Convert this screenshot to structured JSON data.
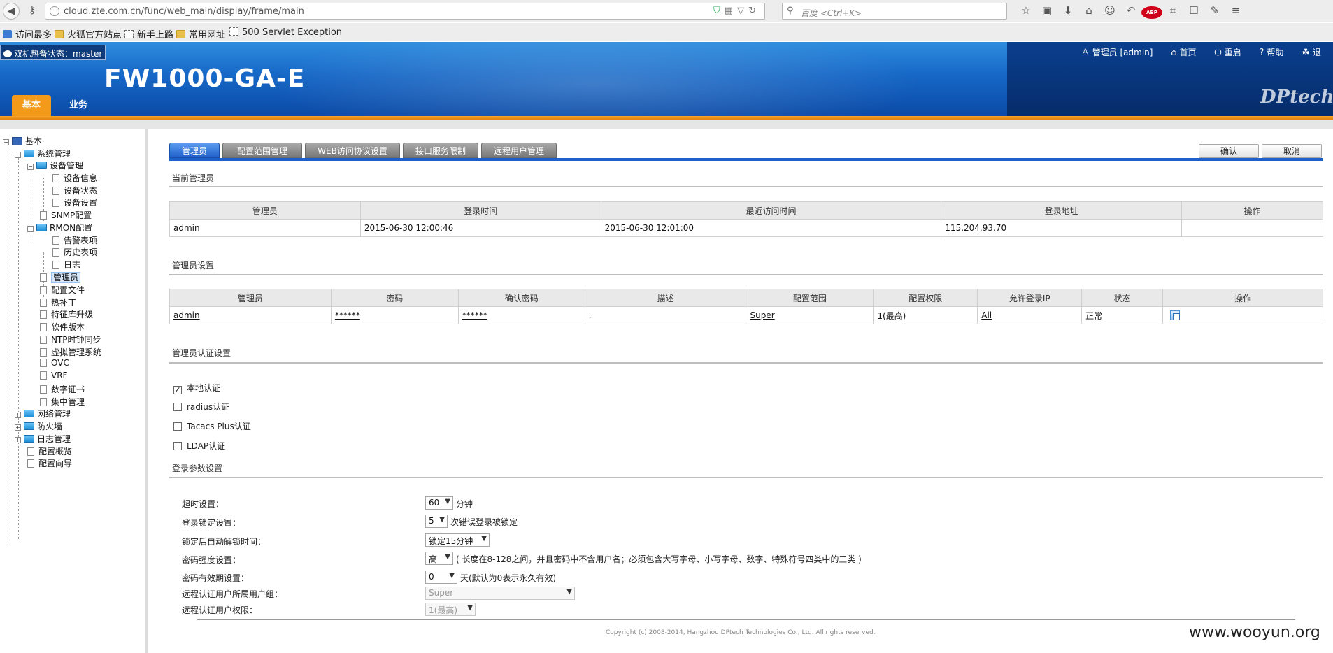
{
  "browser": {
    "url": "cloud.zte.com.cn/func/web_main/display/frame/main",
    "search_placeholder": "百度 <Ctrl+K>",
    "bookmarks": [
      "访问最多",
      "火狐官方站点",
      "新手上路",
      "常用网址",
      "500 Servlet Exception"
    ]
  },
  "header": {
    "ha_status": "双机热备状态：master",
    "product": "FW1000-GA-E",
    "tabs": [
      "基本",
      "业务"
    ],
    "user": "管理员 [admin]",
    "links": [
      "首页",
      "重启",
      "帮助",
      "退"
    ],
    "logo_text": "DPtech"
  },
  "tree": [
    {
      "label": "基本"
    },
    {
      "label": "系统管理"
    },
    {
      "label": "设备管理"
    },
    {
      "label": "设备信息"
    },
    {
      "label": "设备状态"
    },
    {
      "label": "设备设置"
    },
    {
      "label": "SNMP配置"
    },
    {
      "label": "RMON配置"
    },
    {
      "label": "告警表项"
    },
    {
      "label": "历史表项"
    },
    {
      "label": "日志"
    },
    {
      "label": "管理员"
    },
    {
      "label": "配置文件"
    },
    {
      "label": "热补丁"
    },
    {
      "label": "特征库升级"
    },
    {
      "label": "软件版本"
    },
    {
      "label": "NTP时钟同步"
    },
    {
      "label": "虚拟管理系统"
    },
    {
      "label": "OVC"
    },
    {
      "label": "VRF"
    },
    {
      "label": "数字证书"
    },
    {
      "label": "集中管理"
    },
    {
      "label": "网络管理"
    },
    {
      "label": "防火墙"
    },
    {
      "label": "日志管理"
    },
    {
      "label": "配置概览"
    },
    {
      "label": "配置向导"
    }
  ],
  "subtabs": [
    "管理员",
    "配置范围管理",
    "WEB访问协议设置",
    "接口服务限制",
    "远程用户管理"
  ],
  "buttons": {
    "confirm": "确认",
    "cancel": "取消"
  },
  "current_admin": {
    "title": "当前管理员",
    "headers": [
      "管理员",
      "登录时间",
      "最近访问时间",
      "登录地址",
      "操作"
    ],
    "row": [
      "admin",
      "2015-06-30 12:00:46",
      "2015-06-30 12:01:00",
      "115.204.93.70",
      ""
    ]
  },
  "admin_settings": {
    "title": "管理员设置",
    "headers": [
      "管理员",
      "密码",
      "确认密码",
      "描述",
      "配置范围",
      "配置权限",
      "允许登录IP",
      "状态",
      "操作"
    ],
    "row": [
      "admin",
      "******",
      "******",
      ".",
      "Super",
      "1(最高)",
      "All",
      "正常",
      ""
    ]
  },
  "auth": {
    "title": "管理员认证设置",
    "options": [
      {
        "label": "本地认证",
        "checked": true
      },
      {
        "label": "radius认证",
        "checked": false
      },
      {
        "label": "Tacacs Plus认证",
        "checked": false
      },
      {
        "label": "LDAP认证",
        "checked": false
      }
    ]
  },
  "login_params": {
    "title": "登录参数设置",
    "fields": [
      {
        "label": "超时设置：",
        "value": "60",
        "suffix": "分钟"
      },
      {
        "label": "登录锁定设置：",
        "value": "5",
        "suffix": "次错误登录被锁定"
      },
      {
        "label": "锁定后自动解锁时间：",
        "value": "锁定15分钟",
        "suffix": ""
      },
      {
        "label": "密码强度设置：",
        "value": "高",
        "suffix": "( 长度在8-128之间，并且密码中不含用户名；必须包含大写字母、小写字母、数字、特殊符号四类中的三类 )"
      },
      {
        "label": "密码有效期设置：",
        "value": "0",
        "suffix": "天(默认为0表示永久有效)"
      },
      {
        "label": "远程认证用户所属用户组：",
        "value": "Super",
        "suffix": ""
      },
      {
        "label": "远程认证用户权限：",
        "value": "1(最高)",
        "suffix": ""
      }
    ]
  },
  "copyright": "Copyright (c) 2008-2014, Hangzhou DPtech Technologies Co., Ltd. All rights reserved.",
  "watermark": "www.wooyun.org"
}
